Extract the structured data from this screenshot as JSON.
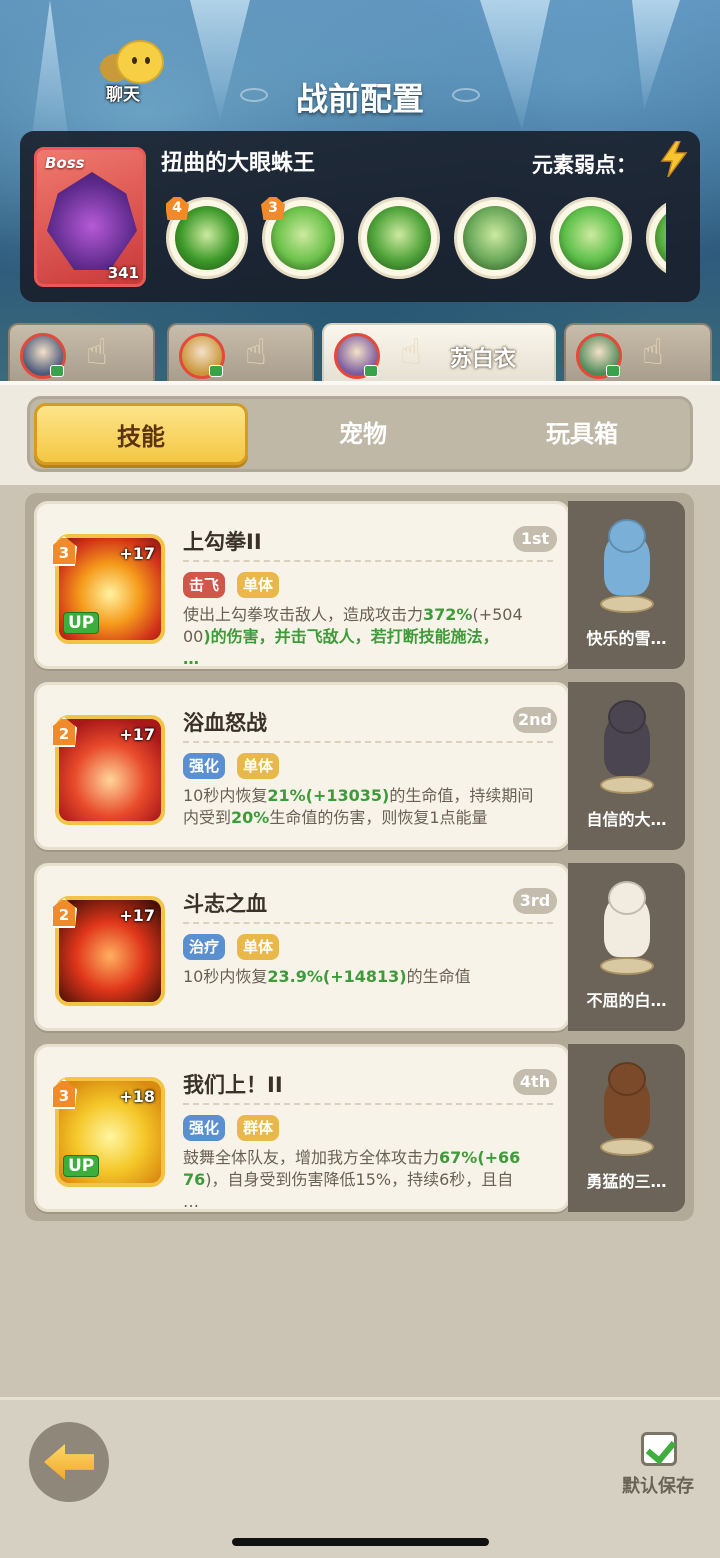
{
  "header": {
    "chat_label": "聊天",
    "title": "战前配置"
  },
  "boss": {
    "badge": "Boss",
    "level": "341",
    "name": "扭曲的大眼蛛王",
    "weakness_label": "元素弱点：",
    "weakness_icon": "lightning-icon",
    "skills": [
      {
        "icon": "green-slash-icon",
        "level": "4",
        "color": "#3d9a2a"
      },
      {
        "icon": "spider-web-icon",
        "level": "3",
        "color": "#6cc24a"
      },
      {
        "icon": "green-demon-icon",
        "level": "",
        "color": "#4fa33a"
      },
      {
        "icon": "boar-icon",
        "level": "",
        "color": "#6aa85a"
      },
      {
        "icon": "green-slime-icon",
        "level": "",
        "color": "#5ec04a"
      },
      {
        "icon": "partial-skill-icon",
        "level": "",
        "color": "#5ab040"
      }
    ]
  },
  "characters": [
    {
      "name": "",
      "avatar_color": "#4a5a7a",
      "active": false
    },
    {
      "name": "",
      "avatar_color": "#c9963a",
      "active": false
    },
    {
      "name": "苏白衣",
      "avatar_color": "#7a5aa0",
      "active": true
    },
    {
      "name": "",
      "avatar_color": "#4f8a5a",
      "active": false
    }
  ],
  "tabs": {
    "skills": "技能",
    "pets": "宠物",
    "toybox": "玩具箱"
  },
  "skills": [
    {
      "name": "上勾拳II",
      "order": "1st",
      "level": "3",
      "plus": "+17",
      "up": "UP",
      "tags": [
        {
          "text": "击飞",
          "color": "#d0564a"
        },
        {
          "text": "单体",
          "color": "#e8b84a"
        }
      ],
      "desc_parts": [
        "使出上勾拳攻击敌人，造成攻击力",
        "372%",
        "(+504\n00",
        ")的伤害，并击飞敌人，若打断技能施法，\n…"
      ],
      "pet_name": "快乐的雪…"
    },
    {
      "name": "浴血怒战",
      "order": "2nd",
      "level": "2",
      "plus": "+17",
      "up": "",
      "tags": [
        {
          "text": "强化",
          "color": "#5a8fd0"
        },
        {
          "text": "单体",
          "color": "#e8b84a"
        }
      ],
      "desc_parts": [
        "10秒内恢复",
        "21%(+13035)",
        "的生命值，持续期间\n内受到",
        "20%",
        "生命值的伤害，则恢复1点能量"
      ],
      "pet_name": "自信的大…"
    },
    {
      "name": "斗志之血",
      "order": "3rd",
      "level": "2",
      "plus": "+17",
      "up": "",
      "tags": [
        {
          "text": "治疗",
          "color": "#5a8fd0"
        },
        {
          "text": "单体",
          "color": "#e8b84a"
        }
      ],
      "desc_parts": [
        "10秒内恢复",
        "23.9%(+14813)",
        "的生命值"
      ],
      "pet_name": "不屈的白…"
    },
    {
      "name": "我们上！II",
      "order": "4th",
      "level": "3",
      "plus": "+18",
      "up": "UP",
      "tags": [
        {
          "text": "强化",
          "color": "#5a8fd0"
        },
        {
          "text": "群体",
          "color": "#e8b84a"
        }
      ],
      "desc_parts": [
        "鼓舞全体队友，增加我方全体攻击力",
        "67%(+66\n76",
        ")，自身受到伤害降低15%，持续6秒，且自\n…"
      ],
      "pet_name": "勇猛的三…"
    }
  ],
  "footer": {
    "save_label": "默认保存"
  }
}
